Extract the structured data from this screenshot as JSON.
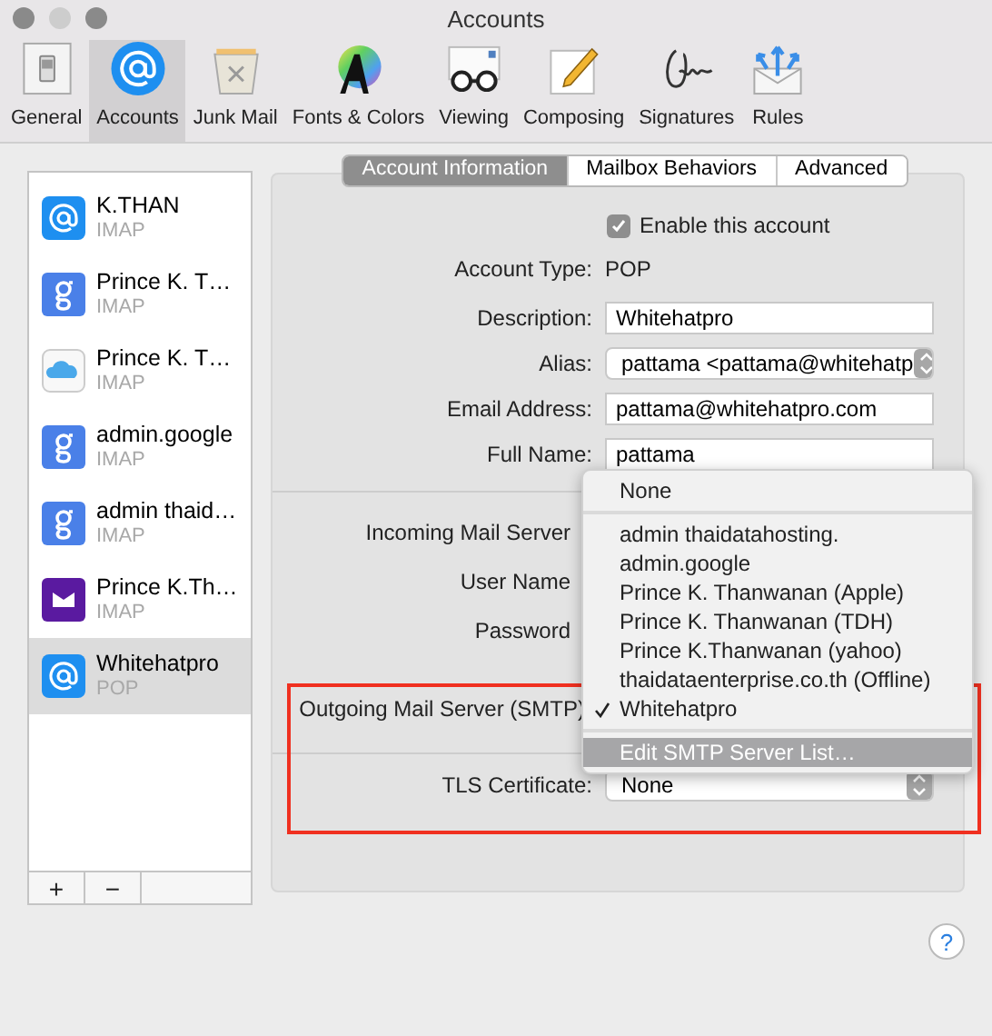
{
  "window": {
    "title": "Accounts"
  },
  "toolbar": [
    {
      "label": "General",
      "kind": "general",
      "selected": false
    },
    {
      "label": "Accounts",
      "kind": "at",
      "selected": true
    },
    {
      "label": "Junk Mail",
      "kind": "junk",
      "selected": false
    },
    {
      "label": "Fonts & Colors",
      "kind": "fonts",
      "selected": false
    },
    {
      "label": "Viewing",
      "kind": "viewing",
      "selected": false
    },
    {
      "label": "Composing",
      "kind": "composing",
      "selected": false
    },
    {
      "label": "Signatures",
      "kind": "signature",
      "selected": false
    },
    {
      "label": "Rules",
      "kind": "rules",
      "selected": false
    }
  ],
  "accounts": [
    {
      "name": "K.THAN",
      "type": "IMAP",
      "kind": "at",
      "selected": false
    },
    {
      "name": "Prince K. T…",
      "type": "IMAP",
      "kind": "g",
      "selected": false
    },
    {
      "name": "Prince K. T…",
      "type": "IMAP",
      "kind": "cloud",
      "selected": false
    },
    {
      "name": "admin.google",
      "type": "IMAP",
      "kind": "g",
      "selected": false
    },
    {
      "name": "admin thaid…",
      "type": "IMAP",
      "kind": "g",
      "selected": false
    },
    {
      "name": "Prince K.Th…",
      "type": "IMAP",
      "kind": "envelope",
      "selected": false
    },
    {
      "name": "Whitehatpro",
      "type": "POP",
      "kind": "at",
      "selected": true
    }
  ],
  "sidebar_buttons": [
    "+",
    "−"
  ],
  "tabs": [
    {
      "label": "Account Information",
      "selected": true
    },
    {
      "label": "Mailbox Behaviors",
      "selected": false
    },
    {
      "label": "Advanced",
      "selected": false
    }
  ],
  "enable_account": {
    "label": "Enable this account",
    "checked": true
  },
  "fields": [
    {
      "kind": "static",
      "label": "Account Type:",
      "value": "POP"
    },
    {
      "kind": "text",
      "label": "Description:",
      "value": "Whitehatpro"
    },
    {
      "kind": "popup",
      "label": "Alias:",
      "value": "pattama <pattama@whitehatp"
    },
    {
      "kind": "text",
      "label": "Email Address:",
      "value": "pattama@whitehatpro.com"
    },
    {
      "kind": "text",
      "label": "Full Name:",
      "value": "pattama"
    }
  ],
  "server_fields": [
    {
      "label": "Incoming Mail Server"
    },
    {
      "label": "User Name"
    },
    {
      "label": "Password"
    }
  ],
  "outgoing": {
    "label": "Outgoing Mail Server (SMTP)"
  },
  "tls": {
    "label": "TLS Certificate:",
    "value": "None"
  },
  "smtp_menu": [
    {
      "kind": "item",
      "label": "None",
      "checked": false,
      "selected": false
    },
    {
      "kind": "separator"
    },
    {
      "kind": "item",
      "label": "admin thaidatahosting.",
      "checked": false,
      "selected": false
    },
    {
      "kind": "item",
      "label": "admin.google",
      "checked": false,
      "selected": false
    },
    {
      "kind": "item",
      "label": "Prince K. Thanwanan (Apple)",
      "checked": false,
      "selected": false
    },
    {
      "kind": "item",
      "label": "Prince K. Thanwanan (TDH)",
      "checked": false,
      "selected": false
    },
    {
      "kind": "item",
      "label": "Prince K.Thanwanan (yahoo)",
      "checked": false,
      "selected": false
    },
    {
      "kind": "item",
      "label": "thaidataenterprise.co.th (Offline)",
      "checked": false,
      "selected": false
    },
    {
      "kind": "item",
      "label": "Whitehatpro",
      "checked": true,
      "selected": false
    },
    {
      "kind": "separator"
    },
    {
      "kind": "item",
      "label": "Edit SMTP Server List…",
      "checked": false,
      "selected": true
    }
  ],
  "help": "?"
}
